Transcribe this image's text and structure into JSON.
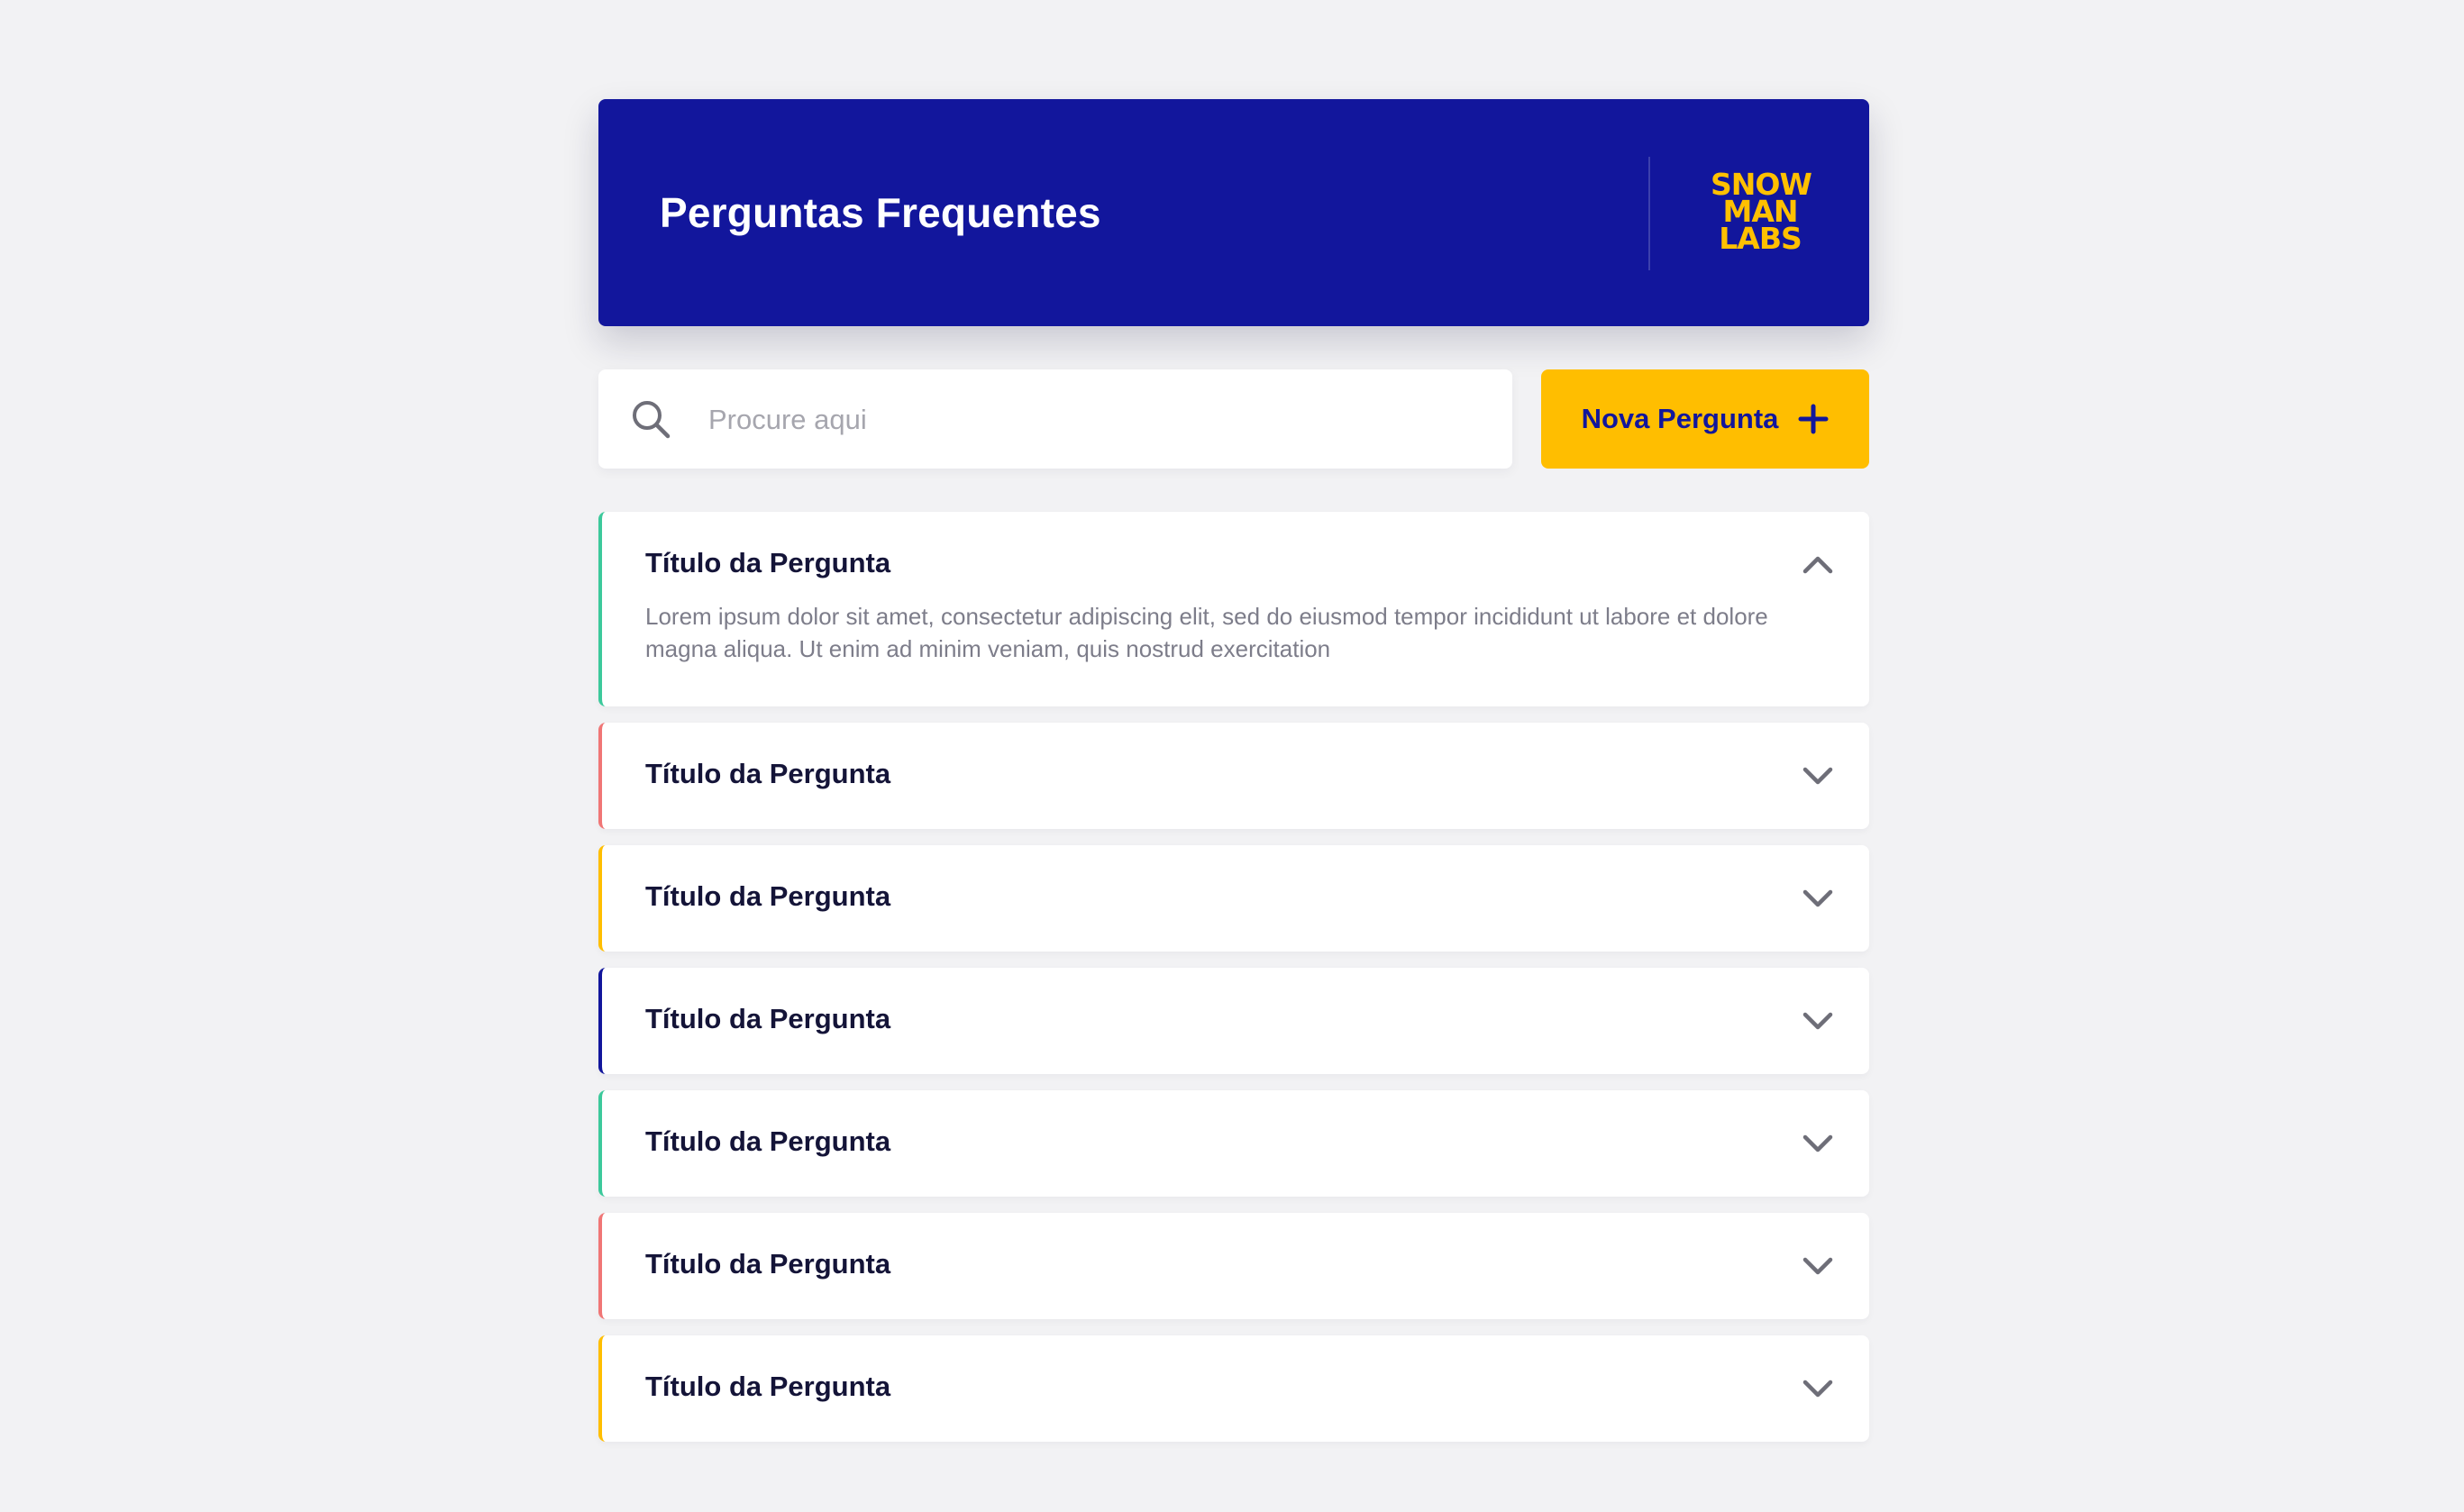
{
  "header": {
    "title": "Perguntas Frequentes",
    "logo_lines": [
      "SNOW",
      "MAN",
      "LABS"
    ]
  },
  "search": {
    "placeholder": "Procure aqui",
    "value": ""
  },
  "new_question_button": {
    "label": "Nova Pergunta",
    "icon": "plus-icon"
  },
  "faq": [
    {
      "title": "Título da Pergunta",
      "body": "Lorem ipsum dolor sit amet, consectetur adipiscing elit, sed do eiusmod tempor incididunt ut labore et dolore magna aliqua. Ut enim ad minim veniam, quis nostrud exercitation",
      "expanded": true,
      "accent": "#3CC99B",
      "icon": "chevron-up-icon"
    },
    {
      "title": "Título da Pergunta",
      "expanded": false,
      "accent": "#F07676",
      "icon": "chevron-down-icon"
    },
    {
      "title": "Título da Pergunta",
      "expanded": false,
      "accent": "#FFBE00",
      "icon": "chevron-down-icon"
    },
    {
      "title": "Título da Pergunta",
      "expanded": false,
      "accent": "#12169C",
      "icon": "chevron-down-icon"
    },
    {
      "title": "Título da Pergunta",
      "expanded": false,
      "accent": "#3CC99B",
      "icon": "chevron-down-icon"
    },
    {
      "title": "Título da Pergunta",
      "expanded": false,
      "accent": "#F07676",
      "icon": "chevron-down-icon"
    },
    {
      "title": "Título da Pergunta",
      "expanded": false,
      "accent": "#FFBE00",
      "icon": "chevron-down-icon"
    }
  ],
  "colors": {
    "background": "#F2F2F4",
    "primary": "#12169C",
    "accent_yellow": "#FFBE00",
    "accent_green": "#3CC99B",
    "accent_red": "#F07676",
    "title_text": "#141438",
    "body_text": "#7D7D8A"
  }
}
